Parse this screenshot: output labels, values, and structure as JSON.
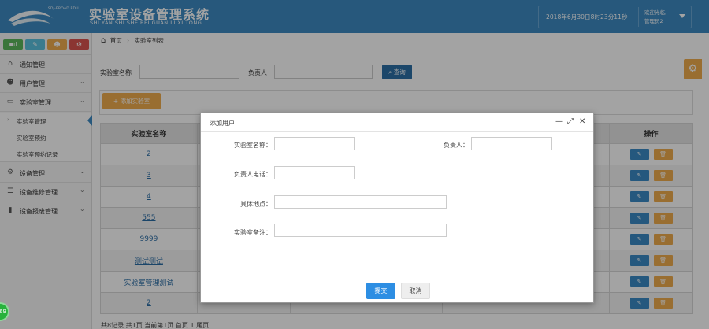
{
  "header": {
    "logo_url": "SDJ-EROAD.EDU",
    "title": "实验室设备管理系统",
    "pinyin": "SHI YAN SHI SHE BEI GUAN LI XI TONG",
    "datetime": "2018年6月30日8时23分11秒",
    "welcome": "欢迎光临,",
    "user": "管理员2",
    "accent": "#3d8ac2"
  },
  "sidebar": {
    "shortcuts": [
      {
        "icon": "signal-icon",
        "glyph": "▪ıl",
        "color": "#5cb85c"
      },
      {
        "icon": "pencil-icon",
        "glyph": "✎",
        "color": "#5bc0de"
      },
      {
        "icon": "users-icon",
        "glyph": "☻",
        "color": "#f0ad4e"
      },
      {
        "icon": "cogs-icon",
        "glyph": "⚙",
        "color": "#d9534f"
      }
    ],
    "menu": [
      {
        "label": "通知管理"
      },
      {
        "label": "用户管理"
      },
      {
        "label": "实验室管理"
      },
      {
        "label": "设备管理"
      },
      {
        "label": "设备维修管理"
      },
      {
        "label": "设备报废管理"
      }
    ],
    "submenu": [
      {
        "label": "实验室管理"
      },
      {
        "label": "实验室预约"
      },
      {
        "label": "实验室预约记录"
      }
    ]
  },
  "breadcrumb": {
    "home": "首页",
    "sep": "›",
    "current": "实验室列表"
  },
  "search": {
    "name_label": "实验室名称",
    "owner_label": "负责人",
    "query_label": "查询"
  },
  "toolbar": {
    "add_label": "+ 添加实验室"
  },
  "table": {
    "col_name": "实验室名称",
    "col_ops": "操作",
    "edit_glyph": "✎",
    "delete_glyph": "🗑",
    "rows": [
      "2",
      "3",
      "4",
      "555",
      "9999",
      "测试测试",
      "实验室管理测试",
      "2"
    ]
  },
  "pager": {
    "text": "共8记录 共1页 当前第1页 首页 1 尾页"
  },
  "modal": {
    "title": "添加用户",
    "fields": {
      "lab_name": "实验室名称：",
      "owner": "负责人：",
      "owner_phone": "负责人电话：",
      "address": "具体地点：",
      "note": "实验室备注："
    },
    "submit": "提交",
    "cancel": "取消"
  },
  "fab": {
    "label": "69"
  }
}
